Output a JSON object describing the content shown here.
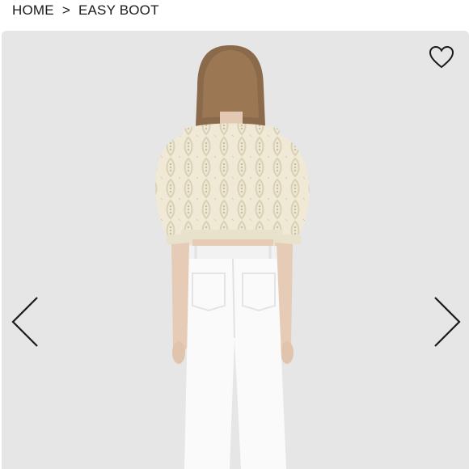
{
  "breadcrumb": {
    "home": "HOME",
    "separator": ">",
    "current": "EASY BOOT"
  },
  "gallery": {
    "background": "#e6e6e7",
    "favorite_icon": "heart-outline-icon",
    "prev_icon": "chevron-left-icon",
    "next_icon": "chevron-right-icon",
    "image": "model-back-view-cream-knit-cropped-sweater-white-jeans"
  }
}
